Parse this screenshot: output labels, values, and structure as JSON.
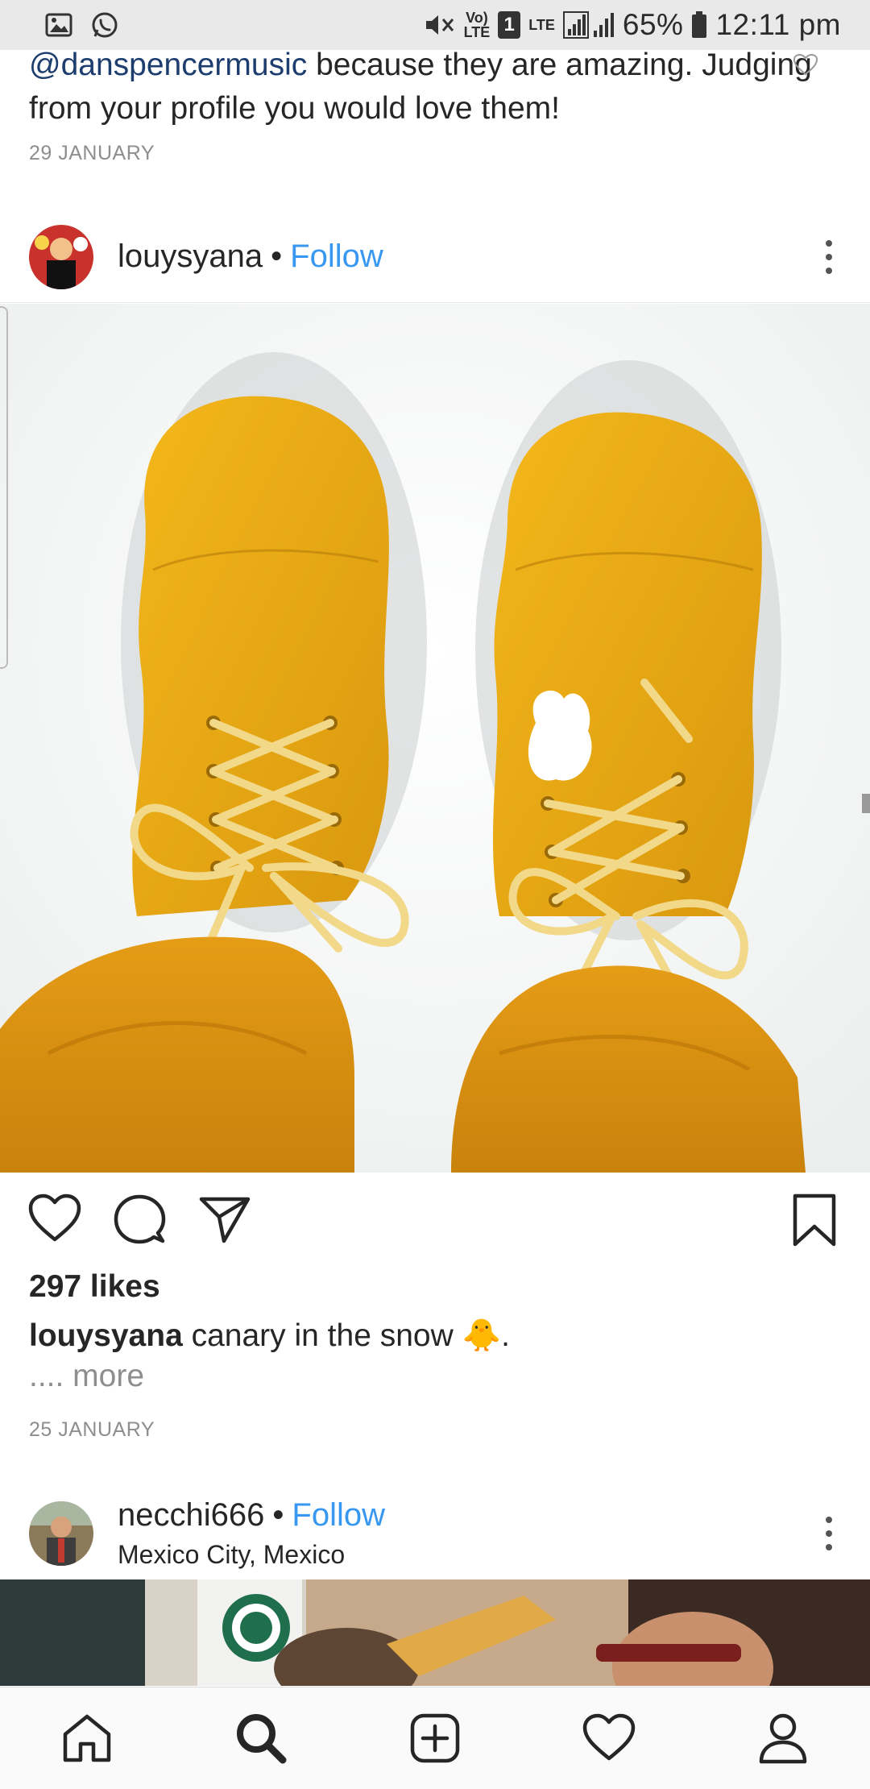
{
  "status_bar": {
    "network_label_top": "Vo)",
    "network_label_bottom": "LTE",
    "sim": "1",
    "lte_label": "LTE",
    "battery": "65%",
    "time": "12:11 pm"
  },
  "prev_comment": {
    "mention": "@danspencermusic",
    "text_rest": " because they are amazing. Judging from your profile you would love them!",
    "date": "29 JANUARY"
  },
  "post": {
    "username": "louysyana",
    "separator": "•",
    "follow_label": "Follow",
    "likes": "297 likes",
    "caption_user": "louysyana",
    "caption_text": " canary in the snow 🐥.",
    "more": ".... more",
    "date": "25 JANUARY"
  },
  "post2": {
    "username": "necchi666",
    "separator": "•",
    "follow_label": "Follow",
    "location": "Mexico City, Mexico"
  },
  "icons": {
    "gallery": "gallery-icon",
    "whatsapp": "whatsapp-icon",
    "mute": "mute-icon",
    "signal": "signal-icon",
    "battery": "battery-icon",
    "like": "heart-icon",
    "comment": "comment-icon",
    "share": "share-icon",
    "save": "bookmark-icon",
    "home": "home-icon",
    "search": "search-icon",
    "add": "add-post-icon",
    "activity": "activity-heart-icon",
    "profile": "profile-icon"
  },
  "colors": {
    "link_blue": "#3897f0",
    "mention": "#1c3d6e",
    "secondary_text": "#8e8e8e",
    "boot_yellow": "#e8a815"
  }
}
